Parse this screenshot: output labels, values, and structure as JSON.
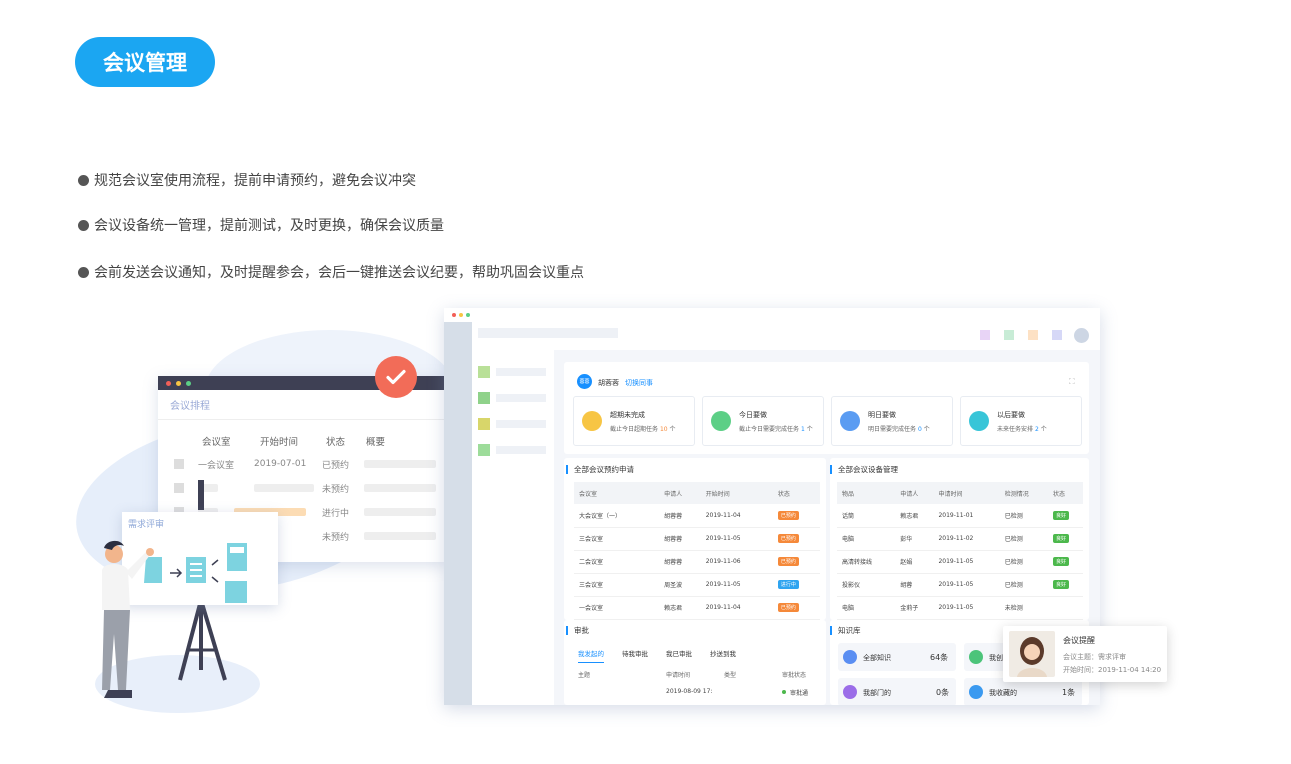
{
  "header": {
    "title": "会议管理"
  },
  "bullets": [
    "规范会议室使用流程，提前申请预约，避免会议冲突",
    "会议设备统一管理，提前测试，及时更换，确保会议质量",
    "会前发送会议通知，及时提醒参会，会后一键推送会议纪要，帮助巩固会议重点"
  ],
  "schedule": {
    "title": "会议排程",
    "columns": [
      "会议室",
      "开始时间",
      "状态",
      "概要"
    ],
    "rows": [
      {
        "room": "一会议室",
        "time": "2019-07-01",
        "status": "已预约"
      },
      {
        "room": "",
        "time": "",
        "status": "未预约"
      },
      {
        "room": "",
        "time": "",
        "status": "进行中"
      },
      {
        "room": "",
        "time": "",
        "status": "未预约"
      }
    ]
  },
  "board": {
    "title": "需求评审"
  },
  "app": {
    "user": {
      "badge": "蓉蓉",
      "name": "胡蓉蓉",
      "switch_label": "切换同事"
    },
    "stats": [
      {
        "title": "超期未完成",
        "desc_prefix": "截止今日超期任务",
        "count": "10",
        "unit": "个",
        "color": "#f7c544"
      },
      {
        "title": "今日要做",
        "desc_prefix": "截止今日需要完成任务",
        "count": "1",
        "unit": "个",
        "color": "#5ccf86"
      },
      {
        "title": "明日要做",
        "desc_prefix": "明日需要完成任务",
        "count": "0",
        "unit": "个",
        "color": "#5a9cf2"
      },
      {
        "title": "以后要做",
        "desc_prefix": "未来任务安排",
        "count": "2",
        "unit": "个",
        "color": "#38c5d8"
      }
    ],
    "booking": {
      "title": "全部会议预约申请",
      "columns": [
        "会议室",
        "申请人",
        "开始时间",
        "状态"
      ],
      "rows": [
        {
          "room": "大会议室（一）",
          "applicant": "胡蓉蓉",
          "date": "2019-11-04",
          "status": "已预约",
          "color": "#f5893a"
        },
        {
          "room": "三会议室",
          "applicant": "胡蓉蓉",
          "date": "2019-11-05",
          "status": "已预约",
          "color": "#f5893a"
        },
        {
          "room": "二会议室",
          "applicant": "胡蓉蓉",
          "date": "2019-11-06",
          "status": "已预约",
          "color": "#f5893a"
        },
        {
          "room": "三会议室",
          "applicant": "周圣波",
          "date": "2019-11-05",
          "status": "进行中",
          "color": "#2fa4f0"
        },
        {
          "room": "一会议室",
          "applicant": "赖志君",
          "date": "2019-11-04",
          "status": "已预约",
          "color": "#f5893a"
        }
      ]
    },
    "equipment": {
      "title": "全部会议设备管理",
      "columns": [
        "物品",
        "申请人",
        "申请时间",
        "检测情况",
        "状态"
      ],
      "rows": [
        {
          "item": "话筒",
          "applicant": "赖志君",
          "date": "2019-11-01",
          "check": "已检测",
          "status": "良好"
        },
        {
          "item": "电脑",
          "applicant": "彭华",
          "date": "2019-11-02",
          "check": "已检测",
          "status": "良好"
        },
        {
          "item": "高清转接线",
          "applicant": "赵娟",
          "date": "2019-11-05",
          "check": "已检测",
          "status": "良好"
        },
        {
          "item": "投影仪",
          "applicant": "胡蓉",
          "date": "2019-11-05",
          "check": "已检测",
          "status": "良好"
        },
        {
          "item": "电脑",
          "applicant": "金莉子",
          "date": "2019-11-05",
          "check": "未检测",
          "status": ""
        }
      ]
    },
    "approval": {
      "title": "审批",
      "tabs": [
        "我发起的",
        "待我审批",
        "我已审批",
        "抄送到我"
      ],
      "columns": [
        "主题",
        "申请时间",
        "类型",
        "审批状态"
      ],
      "row": {
        "date": "2019-08-09 17:",
        "status": "审批通"
      }
    },
    "knowledge": {
      "title": "知识库",
      "items": [
        {
          "label": "全部知识",
          "count": "64条",
          "color": "#5a8ef2"
        },
        {
          "label": "我创",
          "count": "",
          "color": "#4cc47a"
        },
        {
          "label": "我部门的",
          "count": "0条",
          "color": "#9b6de8"
        },
        {
          "label": "我收藏的",
          "count": "1条",
          "color": "#3b9af0"
        }
      ]
    }
  },
  "notification": {
    "title": "会议提醒",
    "subject_label": "会议主题：",
    "subject": "需求评审",
    "time_label": "开始时间：",
    "time": "2019-11-04 14:20"
  }
}
